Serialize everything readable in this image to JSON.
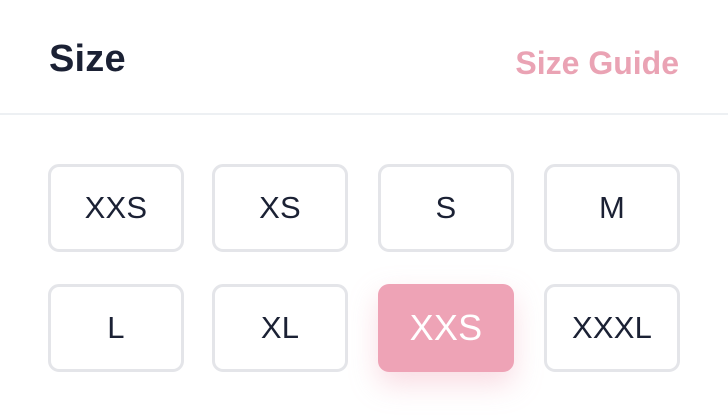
{
  "header": {
    "title": "Size",
    "guide_link": "Size Guide"
  },
  "colors": {
    "accent": "#EEA3B6",
    "link": "#EAA3B4",
    "text": "#1B2134",
    "border": "#E4E5E9"
  },
  "sizes": [
    {
      "label": "XXS",
      "selected": false
    },
    {
      "label": "XS",
      "selected": false
    },
    {
      "label": "S",
      "selected": false
    },
    {
      "label": "M",
      "selected": false
    },
    {
      "label": "L",
      "selected": false
    },
    {
      "label": "XL",
      "selected": false
    },
    {
      "label": "XXS",
      "selected": true
    },
    {
      "label": "XXXL",
      "selected": false
    }
  ]
}
